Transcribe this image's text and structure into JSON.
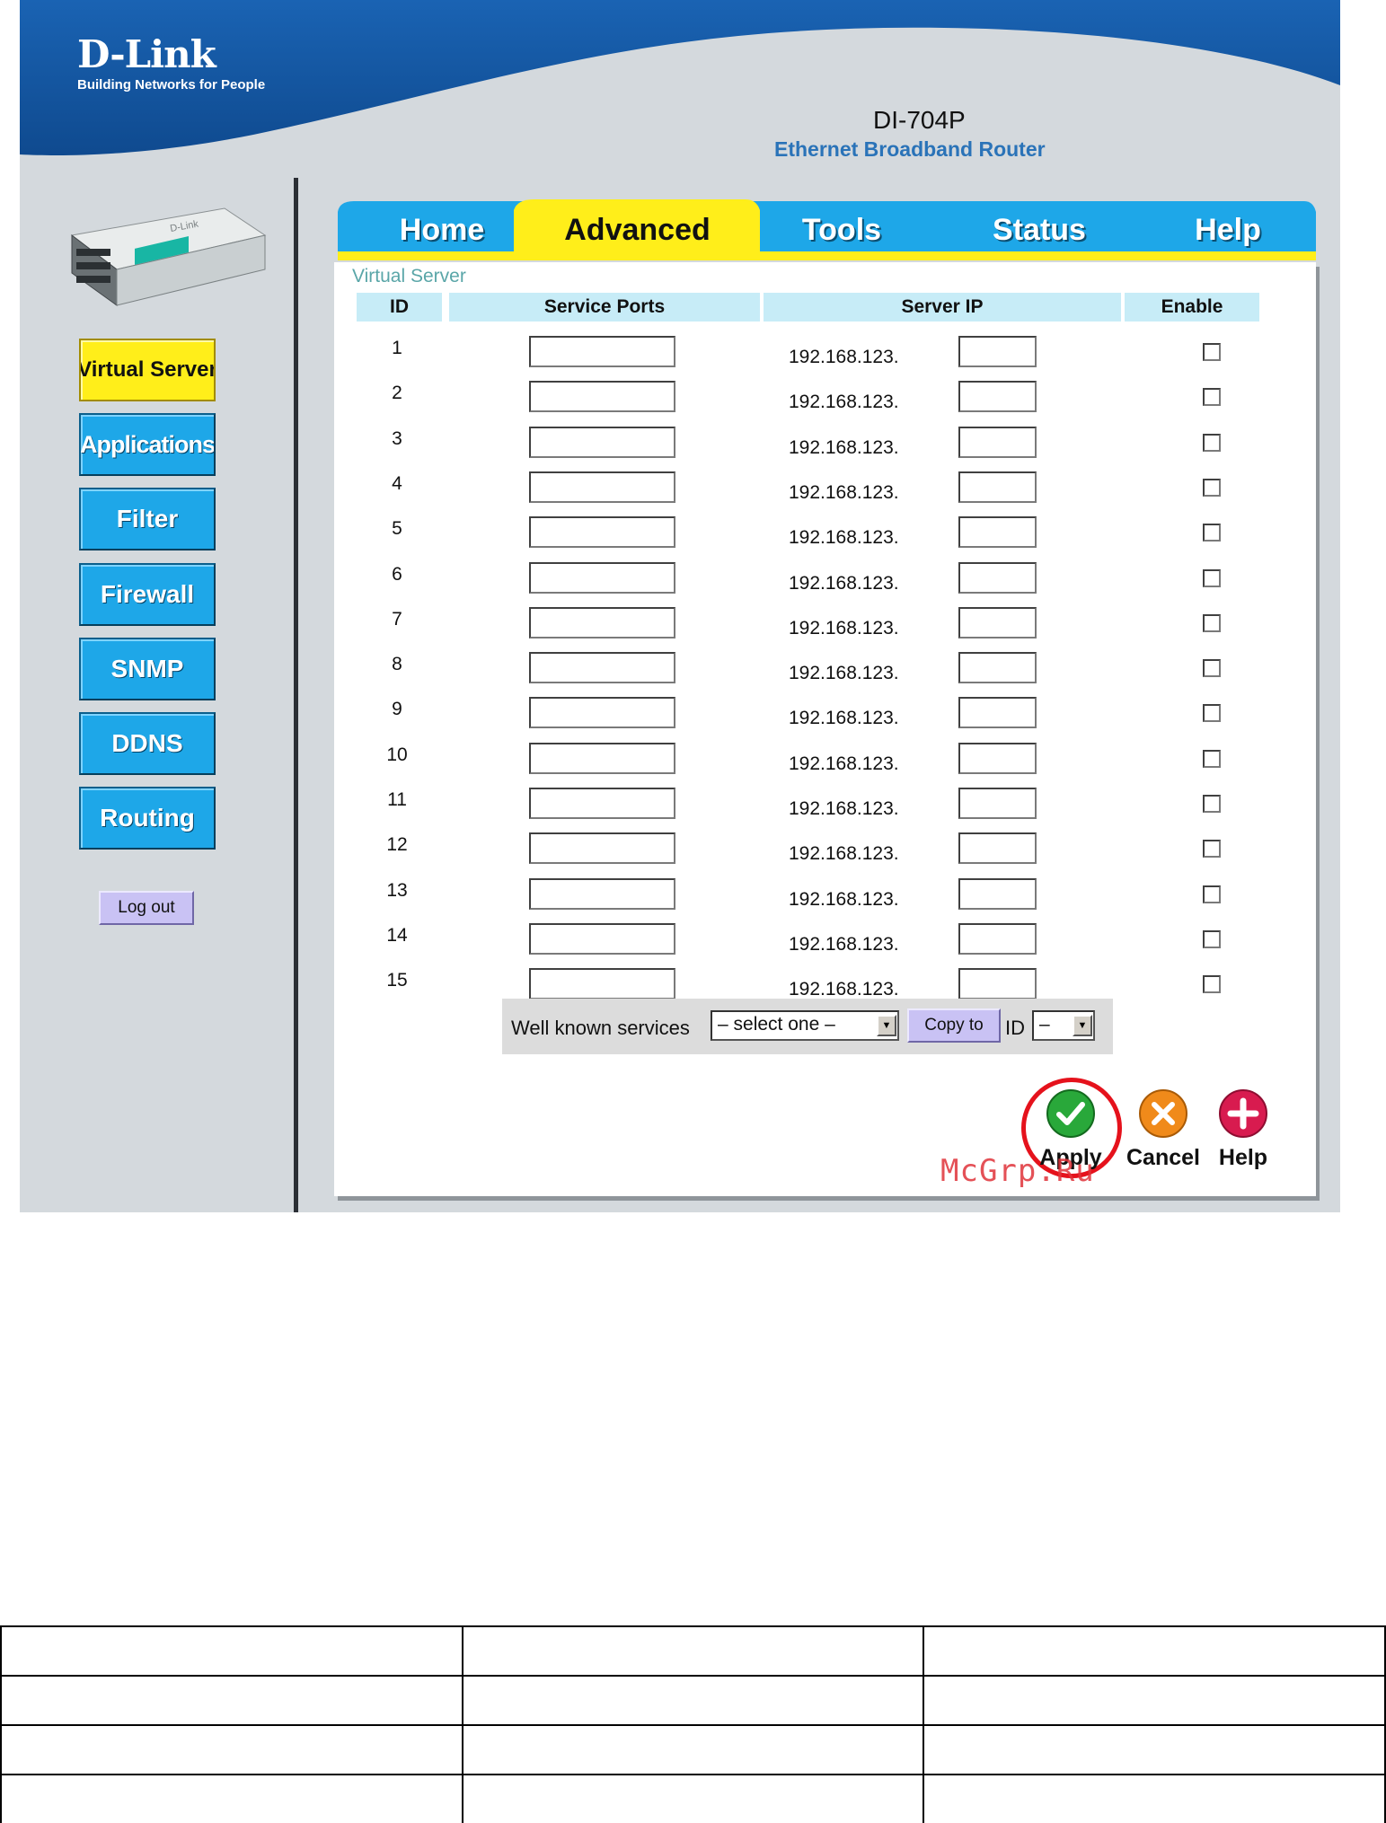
{
  "header": {
    "brand": "D-Link",
    "tagline": "Building Networks for People",
    "model": "DI-704P",
    "product": "Ethernet Broadband Router"
  },
  "tabs": [
    {
      "label": "Home",
      "active": false
    },
    {
      "label": "Advanced",
      "active": true
    },
    {
      "label": "Tools",
      "active": false
    },
    {
      "label": "Status",
      "active": false
    },
    {
      "label": "Help",
      "active": false
    }
  ],
  "sidebar": {
    "items": [
      {
        "label": "Virtual Server",
        "active": true
      },
      {
        "label": "Applications",
        "active": false
      },
      {
        "label": "Filter",
        "active": false
      },
      {
        "label": "Firewall",
        "active": false
      },
      {
        "label": "SNMP",
        "active": false
      },
      {
        "label": "DDNS",
        "active": false
      },
      {
        "label": "Routing",
        "active": false
      }
    ],
    "logout_label": "Log out"
  },
  "virtual_server": {
    "title": "Virtual Server",
    "columns": [
      "ID",
      "Service Ports",
      "Server IP",
      "Enable"
    ],
    "ip_prefix": "192.168.123.",
    "rows": [
      {
        "id": "1",
        "ports": "",
        "ip_octet": "",
        "enabled": false
      },
      {
        "id": "2",
        "ports": "",
        "ip_octet": "",
        "enabled": false
      },
      {
        "id": "3",
        "ports": "",
        "ip_octet": "",
        "enabled": false
      },
      {
        "id": "4",
        "ports": "",
        "ip_octet": "",
        "enabled": false
      },
      {
        "id": "5",
        "ports": "",
        "ip_octet": "",
        "enabled": false
      },
      {
        "id": "6",
        "ports": "",
        "ip_octet": "",
        "enabled": false
      },
      {
        "id": "7",
        "ports": "",
        "ip_octet": "",
        "enabled": false
      },
      {
        "id": "8",
        "ports": "",
        "ip_octet": "",
        "enabled": false
      },
      {
        "id": "9",
        "ports": "",
        "ip_octet": "",
        "enabled": false
      },
      {
        "id": "10",
        "ports": "",
        "ip_octet": "",
        "enabled": false
      },
      {
        "id": "11",
        "ports": "",
        "ip_octet": "",
        "enabled": false
      },
      {
        "id": "12",
        "ports": "",
        "ip_octet": "",
        "enabled": false
      },
      {
        "id": "13",
        "ports": "",
        "ip_octet": "",
        "enabled": false
      },
      {
        "id": "14",
        "ports": "",
        "ip_octet": "",
        "enabled": false
      },
      {
        "id": "15",
        "ports": "",
        "ip_octet": "",
        "enabled": false
      }
    ],
    "well_known_label": "Well known services",
    "service_select_value": "– select one –",
    "copy_label": "Copy to",
    "id_label": "ID",
    "id_select_value": "–"
  },
  "actions": {
    "apply": "Apply",
    "cancel": "Cancel",
    "help": "Help"
  },
  "watermark": "McGrp.Ru",
  "colors": {
    "tab_blue": "#1ea7e8",
    "tab_active": "#ffee1a",
    "header_blue": "#1f6fb8",
    "highlight_ring": "#e5121c"
  },
  "icons": {
    "apply": "check-icon",
    "cancel": "x-icon",
    "help": "plus-icon"
  }
}
